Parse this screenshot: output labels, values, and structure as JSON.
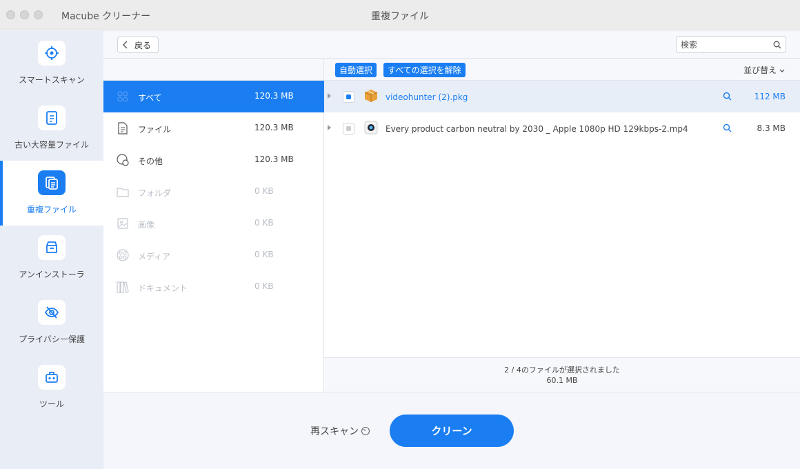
{
  "titlebar": {
    "app_name": "Macube クリーナー",
    "window_title": "重複ファイル"
  },
  "sidebar": {
    "items": [
      {
        "label": "スマートスキャン",
        "icon": "target-icon",
        "active": false
      },
      {
        "label": "古い大容量ファイル",
        "icon": "document-icon",
        "active": false
      },
      {
        "label": "重複ファイル",
        "icon": "duplicate-files-icon",
        "active": true
      },
      {
        "label": "アンインストーラ",
        "icon": "archive-box-icon",
        "active": false
      },
      {
        "label": "プライバシー保護",
        "icon": "eye-off-icon",
        "active": false
      },
      {
        "label": "ツール",
        "icon": "toolbox-icon",
        "active": false
      }
    ]
  },
  "toolbar": {
    "back_label": "戻る",
    "search_placeholder": "検索"
  },
  "categories": [
    {
      "label": "すべて",
      "size": "120.3 MB",
      "icon": "grid-icon",
      "state": "active"
    },
    {
      "label": "ファイル",
      "size": "120.3 MB",
      "icon": "file-icon",
      "state": "normal"
    },
    {
      "label": "その他",
      "size": "120.3 MB",
      "icon": "other-icon",
      "state": "normal"
    },
    {
      "label": "フォルダ",
      "size": "0 KB",
      "icon": "folder-icon",
      "state": "disabled"
    },
    {
      "label": "画像",
      "size": "0 KB",
      "icon": "image-icon",
      "state": "disabled"
    },
    {
      "label": "メディア",
      "size": "0 KB",
      "icon": "media-icon",
      "state": "disabled"
    },
    {
      "label": "ドキュメント",
      "size": "0 KB",
      "icon": "books-icon",
      "state": "disabled"
    }
  ],
  "file_list": {
    "auto_select_label": "自動選択",
    "deselect_all_label": "すべての選択を解除",
    "sort_label": "並び替え",
    "files": [
      {
        "name": "videohunter (2).pkg",
        "size": "112 MB",
        "icon": "package-icon",
        "highlighted": true,
        "checked": true
      },
      {
        "name": "Every product carbon neutral by 2030 _ Apple 1080p HD 129kbps-2.mp4",
        "size": "8.3 MB",
        "icon": "quicktime-icon",
        "highlighted": false,
        "checked": false
      }
    ]
  },
  "summary": {
    "selected_text": "2 / 4のファイルが選択されました",
    "selected_size": "60.1 MB"
  },
  "bottom": {
    "rescan_label": "再スキャン",
    "clean_label": "クリーン"
  },
  "colors": {
    "accent": "#1a7ef2",
    "sidebar_bg": "#e9edf5",
    "disabled_text": "#b8bdc6"
  }
}
